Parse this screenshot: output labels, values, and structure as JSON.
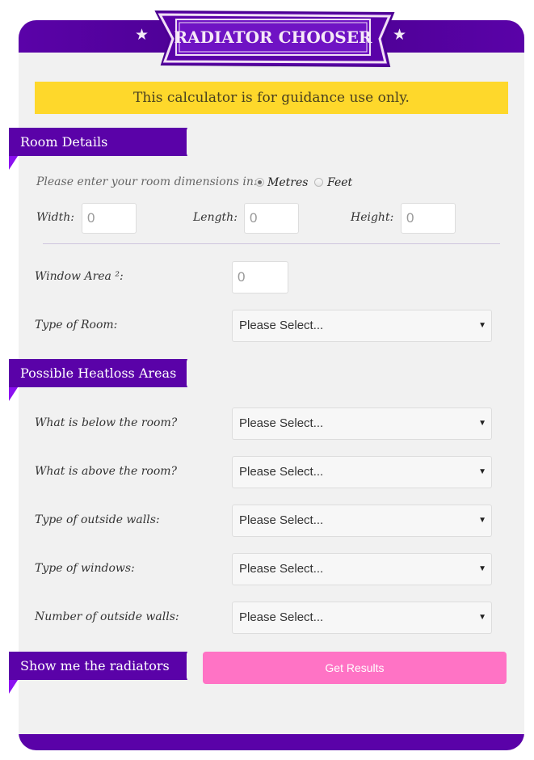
{
  "header": {
    "title": "RADIATOR CHOOSER",
    "star_left": "★",
    "star_right": "★"
  },
  "notice": "This calculator is for guidance use only.",
  "room_details": {
    "section_title": "Room Details",
    "units_prompt": "Please enter your room dimensions in:",
    "units_options": [
      {
        "label": "Metres",
        "selected": true
      },
      {
        "label": "Feet",
        "selected": false
      }
    ],
    "width_label": "Width:",
    "width_value": "0",
    "length_label": "Length:",
    "length_value": "0",
    "height_label": "Height:",
    "height_value": "0",
    "window_area_label": "Window Area ²:",
    "window_area_value": "0",
    "room_type_label": "Type of Room:",
    "room_type_value": "Please Select..."
  },
  "heatloss": {
    "section_title": "Possible Heatloss Areas",
    "fields": [
      {
        "label": "What is below the room?",
        "value": "Please Select..."
      },
      {
        "label": "What is above the room?",
        "value": "Please Select..."
      },
      {
        "label": "Type of outside walls:",
        "value": "Please Select..."
      },
      {
        "label": "Type of windows:",
        "value": "Please Select..."
      },
      {
        "label": "Number of outside walls:",
        "value": "Please Select..."
      }
    ]
  },
  "results": {
    "section_title": "Show me the radiators",
    "button_label": "Get Results"
  },
  "colors": {
    "brand_purple": "#5a02a8",
    "notice_yellow": "#fed82b",
    "button_pink": "#ff73c5"
  }
}
